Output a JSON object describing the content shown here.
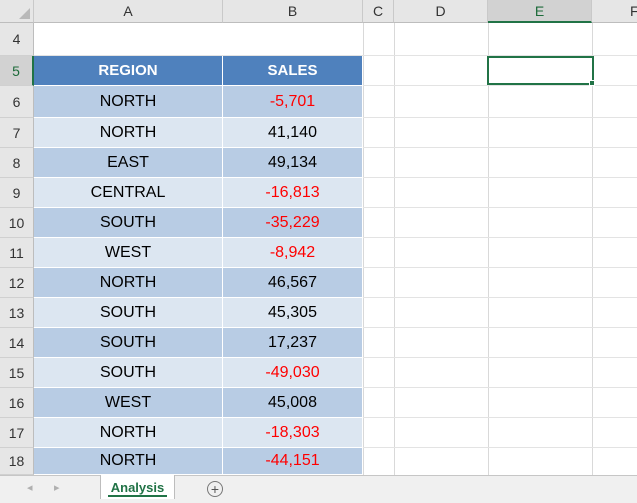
{
  "columns": [
    "A",
    "B",
    "C",
    "D",
    "E",
    "F"
  ],
  "selected_column": "E",
  "selected_row": "5",
  "rows": [
    "4",
    "5",
    "6",
    "7",
    "8",
    "9",
    "10",
    "11",
    "12",
    "13",
    "14",
    "15",
    "16",
    "17",
    "18"
  ],
  "table": {
    "headers": [
      "REGION",
      "SALES"
    ],
    "data": [
      [
        "NORTH",
        "-5,701"
      ],
      [
        "NORTH",
        "41,140"
      ],
      [
        "EAST",
        "49,134"
      ],
      [
        "CENTRAL",
        "-16,813"
      ],
      [
        "SOUTH",
        "-35,229"
      ],
      [
        "WEST",
        "-8,942"
      ],
      [
        "NORTH",
        "46,567"
      ],
      [
        "SOUTH",
        "45,305"
      ],
      [
        "SOUTH",
        "17,237"
      ],
      [
        "SOUTH",
        "-49,030"
      ],
      [
        "WEST",
        "45,008"
      ],
      [
        "NORTH",
        "-18,303"
      ],
      [
        "NORTH",
        "-44,151"
      ]
    ]
  },
  "sheet_tabs": [
    "Analysis"
  ],
  "nav_arrows": {
    "prev": "◂",
    "next": "▸"
  },
  "add_sheet_label": "+",
  "colors": {
    "header_fill": "#4f81bd",
    "band_dark": "#b8cce4",
    "band_light": "#dce6f1",
    "negative_text": "#ff0000",
    "accent": "#217346"
  }
}
